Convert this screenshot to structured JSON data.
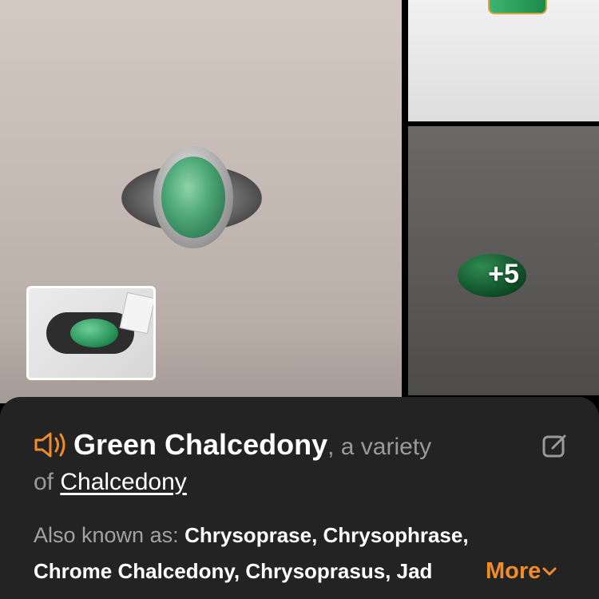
{
  "gallery": {
    "more_count": "+5"
  },
  "info": {
    "name": "Green Chalcedony",
    "variety_text_1": ", a variety",
    "variety_text_2": "of ",
    "variety_link": "Chalcedony",
    "aka_label": "Also known as:",
    "aka_line1": "Chrysoprase, Chrysophrase,",
    "aka_line2": "Chrome Chalcedony, Chrysoprasus, Jad",
    "more_label": "More",
    "speaker_icon": "speaker-icon",
    "edit_icon": "edit-icon",
    "accent_color": "#f28c28"
  }
}
